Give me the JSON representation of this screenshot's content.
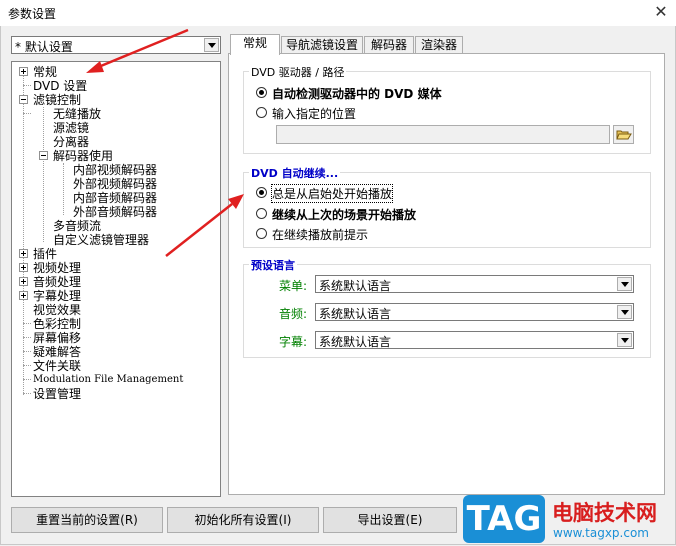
{
  "window": {
    "title": "参数设置",
    "close_glyph": "✕"
  },
  "profile": {
    "value": "* 默认设置"
  },
  "tree": {
    "changgui": "常规",
    "dvd": "DVD 设置",
    "filter": "滤镜控制",
    "seamless": "无缝播放",
    "source": "源滤镜",
    "splitter": "分离器",
    "decoder_use": "解码器使用",
    "int_video": "内部视频解码器",
    "ext_video": "外部视频解码器",
    "int_audio": "内部音频解码器",
    "ext_audio": "外部音频解码器",
    "multi_audio": "多音频流",
    "custom_filter": "自定义滤镜管理器",
    "plugins": "插件",
    "video_proc": "视频处理",
    "audio_proc": "音频处理",
    "sub_proc": "字幕处理",
    "visual": "视觉效果",
    "color": "色彩控制",
    "screen_shift": "屏幕偏移",
    "troubleshoot": "疑难解答",
    "file_assoc": "文件关联",
    "modulation": "Modulation File Management",
    "settings_mgmt": "设置管理"
  },
  "tabs": [
    "常规",
    "导航滤镜设置",
    "解码器",
    "渲染器"
  ],
  "dvd_path": {
    "legend": "DVD 驱动器 / 路径",
    "auto_detect": "自动检测驱动器中的 DVD 媒体",
    "specify": "输入指定的位置",
    "path_value": ""
  },
  "resume": {
    "legend": "DVD 自动继续...",
    "opt1": "总是从启始处开始播放",
    "opt2": "继续从上次的场景开始播放",
    "opt3": "在继续播放前提示"
  },
  "lang": {
    "legend": "预设语言",
    "menu_label": "菜单:",
    "audio_label": "音频:",
    "sub_label": "字幕:",
    "menu_value": "系统默认语言",
    "audio_value": "系统默认语言",
    "sub_value": "系统默认语言"
  },
  "buttons": {
    "reset": "重置当前的设置(R)",
    "init": "初始化所有设置(I)",
    "export": "导出设置(E)"
  },
  "watermark": {
    "logo": "TAG",
    "cn": "电脑技术网",
    "url": "www.tagxp.com"
  },
  "colors": {
    "arrow": "#e02020",
    "accent_blue": "#0000c8",
    "label_green": "#008000"
  }
}
